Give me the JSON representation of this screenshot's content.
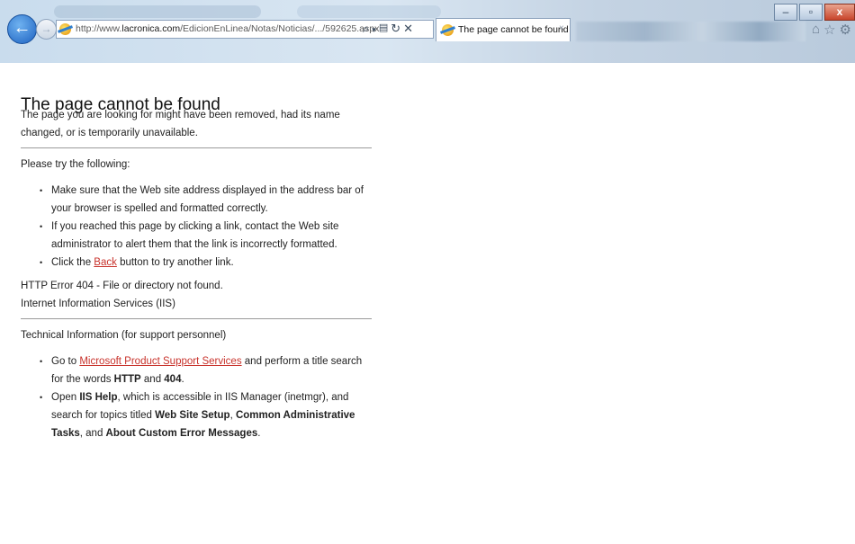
{
  "browser": {
    "url_prefix": "http://www.",
    "url_domain": "lacronica.com",
    "url_path": "/EdicionEnLinea/Notas/Noticias/.../592625.aspx",
    "tab_title": "The page cannot be found",
    "tab_close": "×",
    "back_icon": "arrow-left-icon",
    "forward_icon": "arrow-right-icon",
    "address_tools": [
      "search-icon",
      "dropdown-icon",
      "compat-view-icon",
      "refresh-icon",
      "stop-icon"
    ],
    "window_controls": [
      "minimize",
      "restore",
      "close"
    ],
    "toolbar_icons": [
      "home-icon",
      "favorites-icon",
      "settings-icon"
    ]
  },
  "error_page": {
    "title": "The page cannot be found",
    "intro": "The page you are looking for might have been removed, had its name changed, or is temporarily unavailable.",
    "try_heading": "Please try the following:",
    "tips": {
      "t1": "Make sure that the Web site address displayed in the address bar of your browser is spelled and formatted correctly.",
      "t2": "If you reached this page by clicking a link, contact the Web site administrator to alert them that the link is incorrectly formatted.",
      "t3_pre": "Click the ",
      "t3_link": "Back",
      "t3_post": " button to try another link."
    },
    "error_code": "HTTP Error 404 - File or directory not found.",
    "server": "Internet Information Services (IIS)",
    "tech_heading": "Technical Information (for support personnel)",
    "tech": {
      "a_pre": "Go to ",
      "a_link": "Microsoft Product Support Services",
      "a_mid": " and perform a title search for the words ",
      "a_b1": "HTTP",
      "a_and": " and ",
      "a_b2": "404",
      "a_end": ".",
      "b_pre": "Open ",
      "b_b1": "IIS Help",
      "b_mid": ", which is accessible in IIS Manager (inetmgr), and search for topics titled ",
      "b_b2": "Web Site Setup",
      "b_sep": ", ",
      "b_b3": "Common Administrative Tasks",
      "b_and": ", and ",
      "b_b4": "About Custom Error Messages",
      "b_end": "."
    }
  }
}
